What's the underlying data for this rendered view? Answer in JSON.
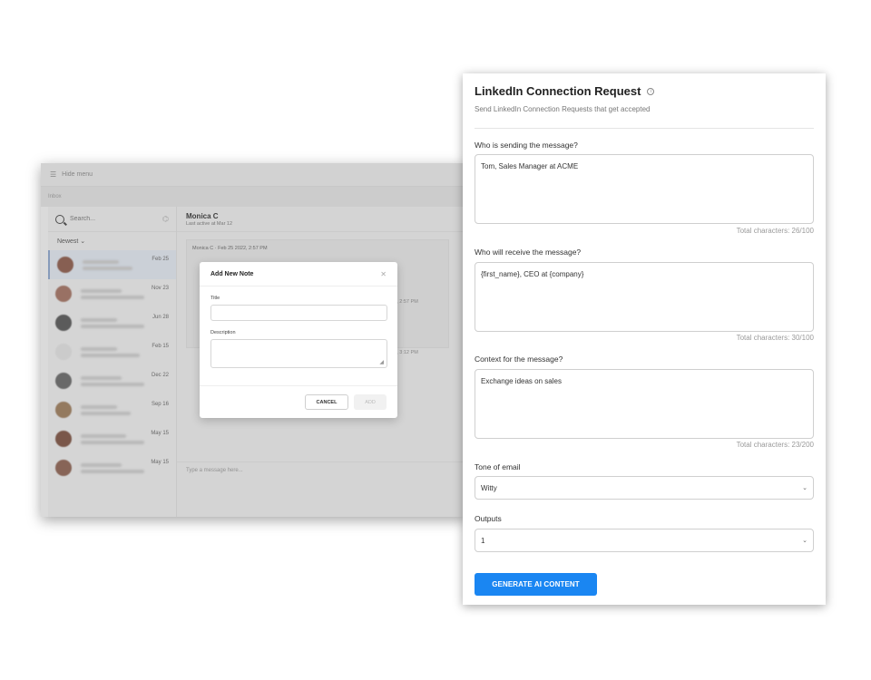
{
  "inbox": {
    "menu_label": "Hide menu",
    "breadcrumb": "Inbox",
    "search_placeholder": "Search...",
    "sort_label": "Newest ⌄",
    "conversations": [
      {
        "date": "Feb 25"
      },
      {
        "date": "Nov 23"
      },
      {
        "date": "Jun 28"
      },
      {
        "date": "Feb 15"
      },
      {
        "date": "Dec 22"
      },
      {
        "date": "Sep 16"
      },
      {
        "date": "May 15"
      },
      {
        "date": "May 15"
      }
    ],
    "chat": {
      "name": "Monica C",
      "last_active": "Last active at Mar 12",
      "message_meta": "Monica C · Feb 25 2022, 2:57 PM",
      "time_1": "2022, 2:57 PM",
      "time_2": "2022, 3:12 PM",
      "input_placeholder": "Type a message here..."
    }
  },
  "note_modal": {
    "title": "Add New Note",
    "title_label": "Title",
    "description_label": "Description",
    "cancel_label": "CANCEL",
    "add_label": "ADD"
  },
  "form": {
    "title": "LinkedIn Connection Request",
    "subtitle": "Send LinkedIn Connection Requests that get accepted",
    "sender_label": "Who is sending the message?",
    "sender_value": "Tom, Sales Manager at ACME",
    "sender_count": "Total characters: 26/100",
    "receiver_label": "Who will receive the message?",
    "receiver_value": "{first_name}, CEO at {company}",
    "receiver_count": "Total characters: 30/100",
    "context_label": "Context for the message?",
    "context_value": "Exchange ideas on sales",
    "context_count": "Total characters: 23/200",
    "tone_label": "Tone of email",
    "tone_value": "Witty",
    "outputs_label": "Outputs",
    "outputs_value": "1",
    "generate_label": "GENERATE AI CONTENT"
  },
  "colors": {
    "accent": "#1a86f2"
  }
}
